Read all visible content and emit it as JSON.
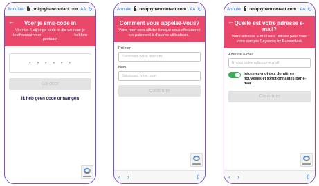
{
  "screens": [
    {
      "urlbar": {
        "cancel": "Annuleer",
        "host": "oniqbybancontact.com",
        "text_size": "AA",
        "reload": "↻"
      },
      "back_glyph": "←",
      "title": "Voer je sms-code in",
      "subtitle_line1": "Voer de 6-cijferige code in die we naar je",
      "subtitle_left": "telefoonnummer",
      "subtitle_right": "hebben",
      "subtitle_line3": "gestuurd",
      "code_placeholder": [
        "•",
        "•",
        "•",
        "•",
        "•",
        "•"
      ],
      "button": "Ga door",
      "link": "Ik heb geen code ontvangen"
    },
    {
      "urlbar": {
        "cancel": "Annuler",
        "host": "oniqbybancontact.com",
        "text_size": "AA",
        "reload": "↻"
      },
      "title": "Comment vous appelez-vous?",
      "subtitle": "Votre nom sera affiché lorsque vous effectuerez un paiement à d'autres utilisateurs.",
      "first_name_label": "Prénom",
      "first_name_placeholder": "Saisissez votre prénom",
      "last_name_label": "Nom",
      "last_name_placeholder": "Saisissez votre nom",
      "button": "Continuer",
      "nav": {
        "back": "‹",
        "forward": "›",
        "share": "⇧"
      }
    },
    {
      "urlbar": {
        "cancel": "Annuler",
        "host": "oniqbybancontact.com",
        "text_size": "AA",
        "reload": "↻"
      },
      "back_glyph": "←",
      "title": "Quelle est votre adresse e-mail?",
      "subtitle": "Votre adresse e-mail sera utilisée pour créer votre compte Payconiq by Bancontact.",
      "email_label": "Adresse e-mail",
      "email_placeholder": "Entrez votre adresse e-mail",
      "toggle_label": "Informez-moi des dernières nouvelles et fonctionnalités par e-mail",
      "toggle_on": true,
      "button": "Continuer",
      "nav": {
        "back": "‹",
        "forward": "›",
        "share": "⇧"
      }
    }
  ],
  "colors": {
    "frame": "#7b4fd6",
    "hero": "#e9486b",
    "toggle": "#3dab5b",
    "link": "#1e7cf2"
  }
}
